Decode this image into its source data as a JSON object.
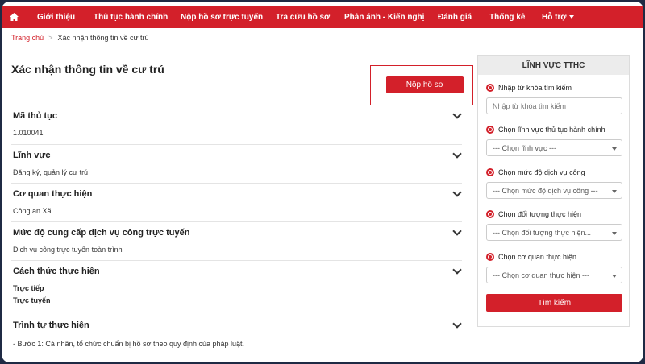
{
  "nav": {
    "items": [
      {
        "label": "Giới thiệu"
      },
      {
        "label": "Thủ tục hành chính"
      },
      {
        "label": "Nộp hồ sơ trực tuyến"
      },
      {
        "label": "Tra cứu hồ sơ"
      },
      {
        "label": "Phản ánh - Kiến nghị"
      },
      {
        "label": "Đánh giá"
      },
      {
        "label": "Thống kê"
      },
      {
        "label": "Hỗ trợ"
      }
    ]
  },
  "breadcrumb": {
    "home": "Trang chủ",
    "separator": ">",
    "current": "Xác nhận thông tin về cư trú"
  },
  "page": {
    "title": "Xác nhận thông tin về cư trú",
    "submit_label": "Nộp hồ sơ"
  },
  "sections": [
    {
      "heading": "Mã thủ tục",
      "content": [
        "1.010041"
      ]
    },
    {
      "heading": "Lĩnh vực",
      "content": [
        "Đăng ký, quản lý cư trú"
      ]
    },
    {
      "heading": "Cơ quan thực hiện",
      "content": [
        "Công an Xã"
      ]
    },
    {
      "heading": "Mức độ cung cấp dịch vụ công trực tuyến",
      "content": [
        "Dịch vụ công trực tuyến toàn trình"
      ]
    },
    {
      "heading": "Cách thức thực hiện",
      "content": [
        "Trực tiếp",
        "Trực tuyến"
      ]
    },
    {
      "heading": "Trình tự thực hiện",
      "content": [
        "- Bước 1: Cá nhân, tổ chức chuẩn bị hồ sơ theo quy định của pháp luật."
      ]
    }
  ],
  "sidebar": {
    "title": "LĨNH VỰC TTHC",
    "keyword_label": "Nhập từ khóa tìm kiếm",
    "keyword_placeholder": "Nhập từ khóa tìm kiếm",
    "field_label": "Chọn lĩnh vực thủ tục hành chính",
    "field_value": "--- Chọn lĩnh vực ---",
    "level_label": "Chọn mức độ dịch vụ công",
    "level_value": "--- Chọn mức độ dịch vụ công ---",
    "subject_label": "Chọn đối tượng thực hiện",
    "subject_value": "--- Chọn đối tượng thực hiện...",
    "agency_label": "Chọn cơ quan thực hiện",
    "agency_value": "--- Chọn cơ quan thực hiện ---",
    "search_label": "Tìm kiếm"
  },
  "colors": {
    "brand_red": "#d3202a"
  },
  "icons": {
    "home": "home-icon",
    "chevron": "chevron-down-icon",
    "radio": "radio-selected-icon"
  }
}
